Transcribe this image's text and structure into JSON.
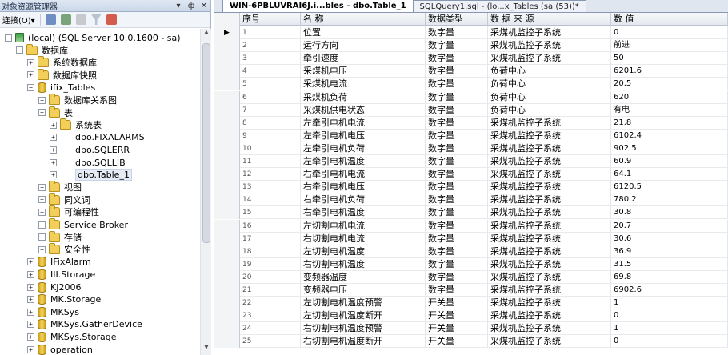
{
  "explorer": {
    "title": "对象资源管理器",
    "title_buttons": [
      "▾",
      "ф",
      "✕"
    ],
    "toolbar_connect": "连接(O)▾",
    "tree": [
      {
        "label": "(local) (SQL Server 10.0.1600 - sa)",
        "icon": "server-icon",
        "expander": "−",
        "level": 0
      },
      {
        "label": "数据库",
        "icon": "folder-icon",
        "expander": "−",
        "level": 1
      },
      {
        "label": "系统数据库",
        "icon": "folder-icon",
        "expander": "+",
        "level": 2
      },
      {
        "label": "数据库快照",
        "icon": "folder-icon",
        "expander": "+",
        "level": 2
      },
      {
        "label": "ifix_Tables",
        "icon": "database-icon",
        "expander": "−",
        "level": 2
      },
      {
        "label": "数据库关系图",
        "icon": "folder-icon",
        "expander": "+",
        "level": 3
      },
      {
        "label": "表",
        "icon": "folder-icon",
        "expander": "−",
        "level": 3
      },
      {
        "label": "系统表",
        "icon": "folder-icon",
        "expander": "+",
        "level": 4
      },
      {
        "label": "dbo.FIXALARMS",
        "icon": "table-icon",
        "expander": "+",
        "level": 4
      },
      {
        "label": "dbo.SQLERR",
        "icon": "table-icon",
        "expander": "+",
        "level": 4
      },
      {
        "label": "dbo.SQLLIB",
        "icon": "table-icon",
        "expander": "+",
        "level": 4
      },
      {
        "label": "dbo.Table_1",
        "icon": "table-icon",
        "expander": "+",
        "level": 4,
        "selected": true
      },
      {
        "label": "视图",
        "icon": "folder-icon",
        "expander": "+",
        "level": 3
      },
      {
        "label": "同义词",
        "icon": "folder-icon",
        "expander": "+",
        "level": 3
      },
      {
        "label": "可编程性",
        "icon": "folder-icon",
        "expander": "+",
        "level": 3
      },
      {
        "label": "Service Broker",
        "icon": "folder-icon",
        "expander": "+",
        "level": 3
      },
      {
        "label": "存储",
        "icon": "folder-icon",
        "expander": "+",
        "level": 3
      },
      {
        "label": "安全性",
        "icon": "folder-icon",
        "expander": "+",
        "level": 3
      },
      {
        "label": "IFixAlarm",
        "icon": "database-icon",
        "expander": "+",
        "level": 2
      },
      {
        "label": "III.Storage",
        "icon": "database-icon",
        "expander": "+",
        "level": 2
      },
      {
        "label": "KJ2006",
        "icon": "database-icon",
        "expander": "+",
        "level": 2
      },
      {
        "label": "MK.Storage",
        "icon": "database-icon",
        "expander": "+",
        "level": 2
      },
      {
        "label": "MKSys",
        "icon": "database-icon",
        "expander": "+",
        "level": 2
      },
      {
        "label": "MKSys.GatherDevice",
        "icon": "database-icon",
        "expander": "+",
        "level": 2
      },
      {
        "label": "MKSys.Storage",
        "icon": "database-icon",
        "expander": "+",
        "level": 2
      },
      {
        "label": "operation",
        "icon": "database-icon",
        "expander": "+",
        "level": 2
      }
    ]
  },
  "tabs": [
    {
      "label": "WIN-6PBLUVRAI6J.i...bles - dbo.Table_1",
      "active": true
    },
    {
      "label": "SQLQuery1.sql - (lo...x_Tables (sa (53))*",
      "active": false
    }
  ],
  "grid": {
    "current_row_marker": "▶",
    "columns": [
      "序号",
      "名  称",
      "数据类型",
      "数 据 来 源",
      "数  值"
    ],
    "rows": [
      [
        "1",
        "位置",
        "数字量",
        "采煤机监控子系统",
        "0"
      ],
      [
        "2",
        "运行方向",
        "数字量",
        "采煤机监控子系统",
        "前进"
      ],
      [
        "3",
        "牵引速度",
        "数字量",
        "采煤机监控子系统",
        "50"
      ],
      [
        "4",
        "采煤机电压",
        "数字量",
        "负荷中心",
        "6201.6"
      ],
      [
        "5",
        "采煤机电流",
        "数字量",
        "负荷中心",
        "20.5"
      ],
      [
        "6",
        "采煤机负荷",
        "数字量",
        "负荷中心",
        "620"
      ],
      [
        "7",
        "采煤机供电状态",
        "数字量",
        "负荷中心",
        "有电"
      ],
      [
        "8",
        "左牵引电机电流",
        "数字量",
        "采煤机监控子系统",
        "21.8"
      ],
      [
        "9",
        "左牵引电机电压",
        "数字量",
        "采煤机监控子系统",
        "6102.4"
      ],
      [
        "10",
        "左牵引电机负荷",
        "数字量",
        "采煤机监控子系统",
        "902.5"
      ],
      [
        "11",
        "左牵引电机温度",
        "数字量",
        "采煤机监控子系统",
        "60.9"
      ],
      [
        "12",
        "右牵引电机电流",
        "数字量",
        "采煤机监控子系统",
        "64.1"
      ],
      [
        "13",
        "右牵引电机电压",
        "数字量",
        "采煤机监控子系统",
        "6120.5"
      ],
      [
        "14",
        "右牵引电机负荷",
        "数字量",
        "采煤机监控子系统",
        "780.2"
      ],
      [
        "15",
        "右牵引电机温度",
        "数字量",
        "采煤机监控子系统",
        "30.8"
      ],
      [
        "16",
        "左切割电机电流",
        "数字量",
        "采煤机监控子系统",
        "20.7"
      ],
      [
        "17",
        "右切割电机电流",
        "数字量",
        "采煤机监控子系统",
        "30.6"
      ],
      [
        "18",
        "左切割电机温度",
        "数字量",
        "采煤机监控子系统",
        "36.9"
      ],
      [
        "19",
        "右切割电机温度",
        "数字量",
        "采煤机监控子系统",
        "31.5"
      ],
      [
        "20",
        "变频器温度",
        "数字量",
        "采煤机监控子系统",
        "69.8"
      ],
      [
        "21",
        "变频器电压",
        "数字量",
        "采煤机监控子系统",
        "6902.6"
      ],
      [
        "22",
        "左切割电机温度预警",
        "开关量",
        "采煤机监控子系统",
        "1"
      ],
      [
        "23",
        "左切割电机温度断开",
        "开关量",
        "采煤机监控子系统",
        "0"
      ],
      [
        "24",
        "右切割电机温度预警",
        "开关量",
        "采煤机监控子系统",
        "1"
      ],
      [
        "25",
        "右切割电机温度断开",
        "开关量",
        "采煤机监控子系统",
        "0"
      ]
    ]
  }
}
